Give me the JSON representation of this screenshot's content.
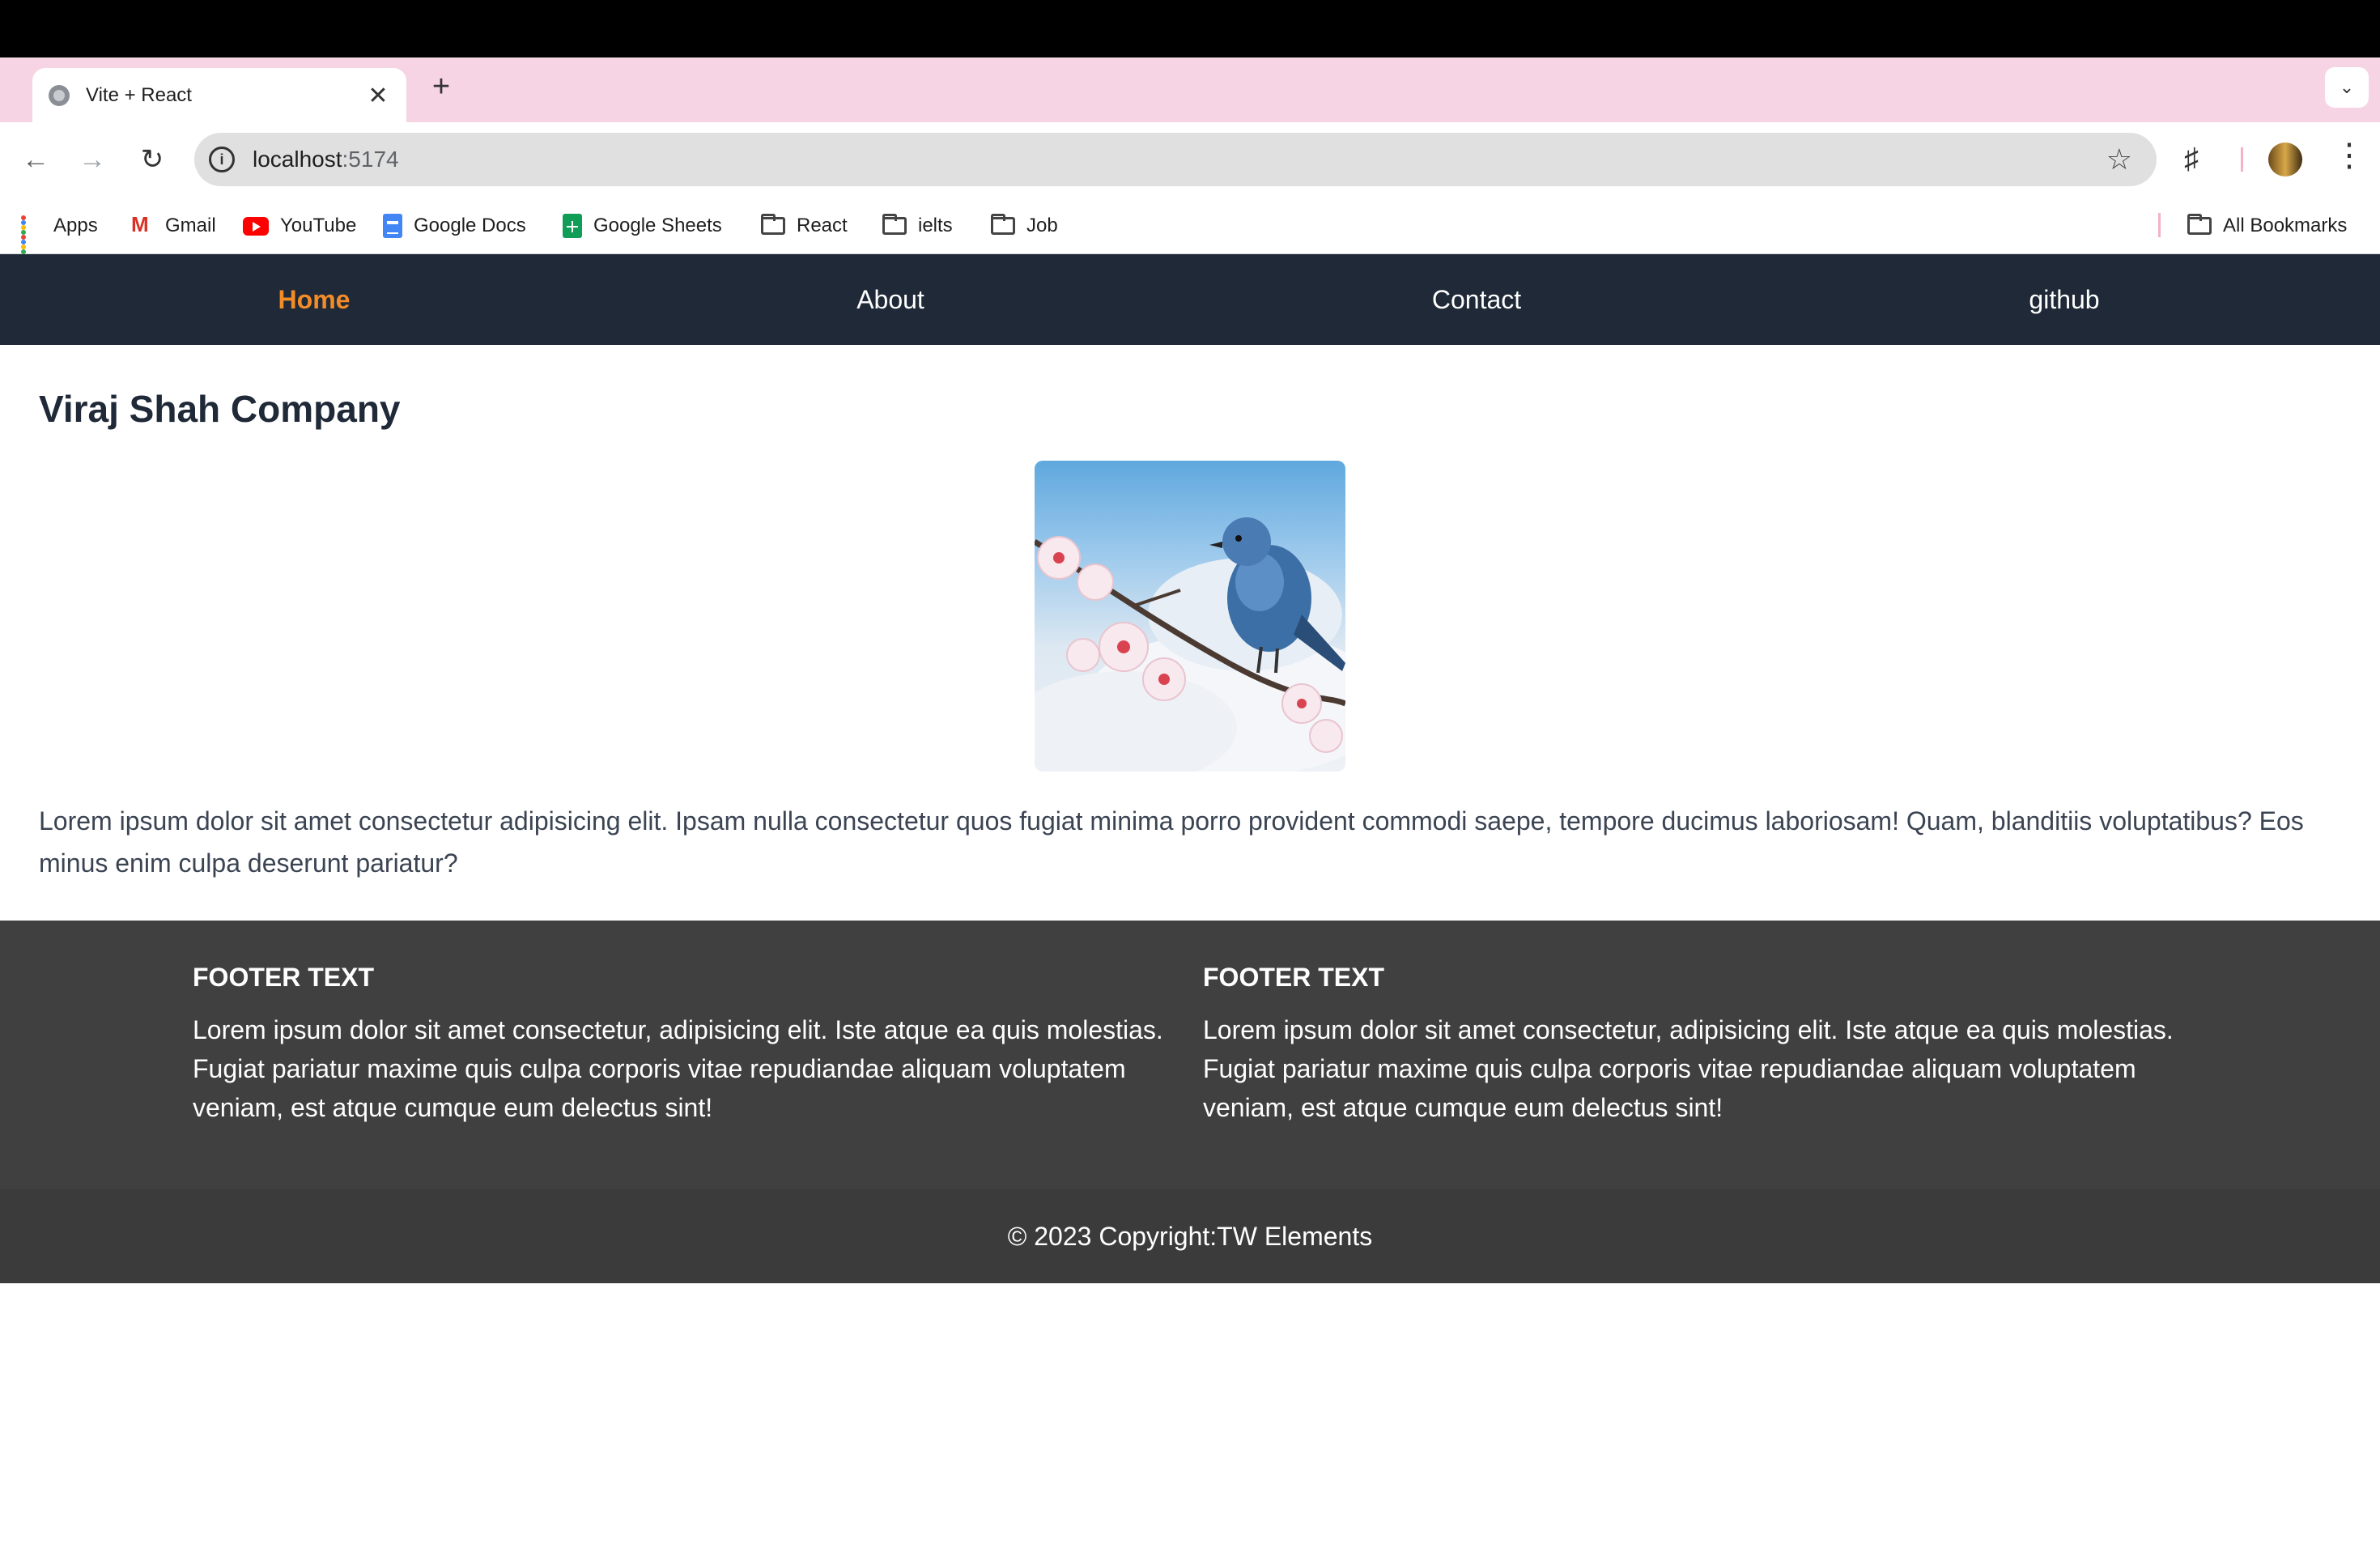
{
  "browser": {
    "tab_title": "Vite + React",
    "url_host": "localhost",
    "url_port": ":5174",
    "new_tab_glyph": "+",
    "close_glyph": "✕"
  },
  "bookmarks": [
    {
      "label": "Apps",
      "icon": "apps-grid-icon"
    },
    {
      "label": "Gmail",
      "icon": "gmail-icon"
    },
    {
      "label": "YouTube",
      "icon": "youtube-icon"
    },
    {
      "label": "Google Docs",
      "icon": "google-docs-icon"
    },
    {
      "label": "Google Sheets",
      "icon": "google-sheets-icon"
    },
    {
      "label": "React",
      "icon": "folder-icon"
    },
    {
      "label": "ielts",
      "icon": "folder-icon"
    },
    {
      "label": "Job",
      "icon": "folder-icon"
    }
  ],
  "all_bookmarks_label": "All Bookmarks",
  "nav": {
    "items": [
      {
        "label": "Home",
        "active": true
      },
      {
        "label": "About",
        "active": false
      },
      {
        "label": "Contact",
        "active": false
      },
      {
        "label": "github",
        "active": false
      }
    ]
  },
  "main": {
    "title": "Viraj Shah Company",
    "paragraph": "Lorem ipsum dolor sit amet consectetur adipisicing elit. Ipsam nulla consectetur quos fugiat minima porro provident commodi saepe, tempore ducimus laboriosam! Quam, blanditiis voluptatibus? Eos minus enim culpa deserunt pariatur?"
  },
  "footer": {
    "columns": [
      {
        "heading": "FOOTER TEXT",
        "text": "Lorem ipsum dolor sit amet consectetur, adipisicing elit. Iste atque ea quis molestias. Fugiat pariatur maxime quis culpa corporis vitae repudiandae aliquam voluptatem veniam, est atque cumque eum delectus sint!"
      },
      {
        "heading": "FOOTER TEXT",
        "text": "Lorem ipsum dolor sit amet consectetur, adipisicing elit. Iste atque ea quis molestias. Fugiat pariatur maxime quis culpa corporis vitae repudiandae aliquam voluptatem veniam, est atque cumque eum delectus sint!"
      }
    ],
    "copyright": "© 2023 Copyright:TW Elements"
  },
  "colors": {
    "nav_bg": "#1f2937",
    "nav_active": "#f28c28",
    "footer_bg": "#404040",
    "tabstrip_bg": "#f6d4e4"
  }
}
